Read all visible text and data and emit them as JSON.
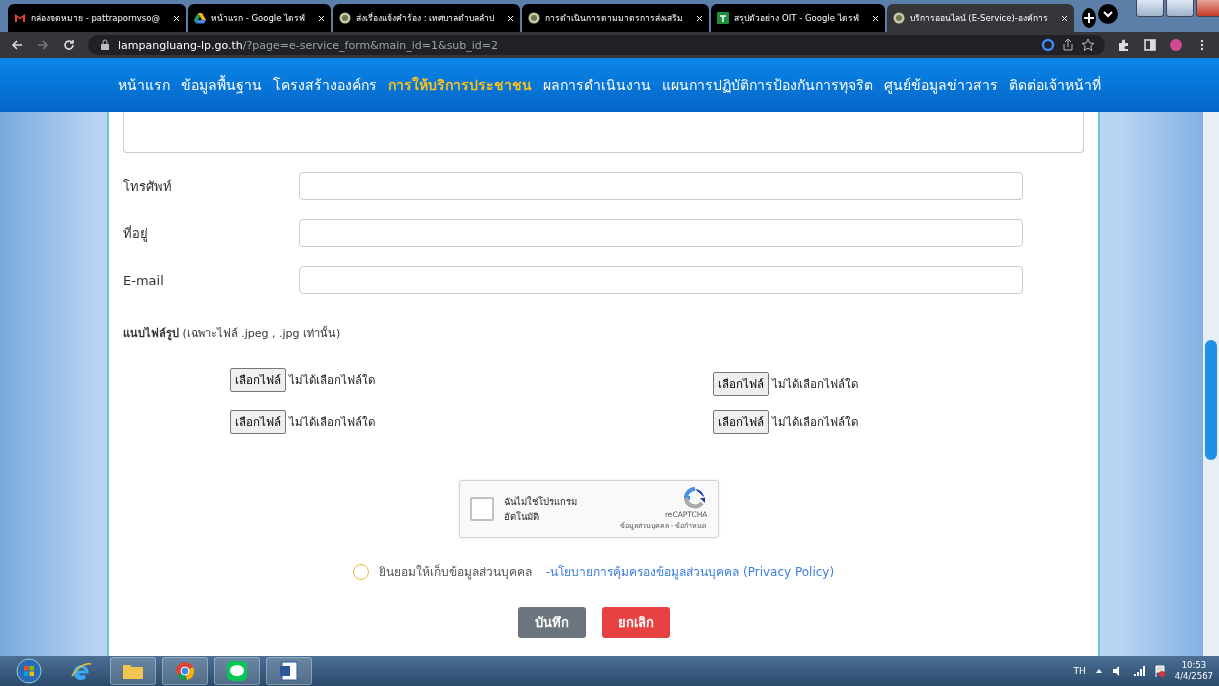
{
  "browser": {
    "tabs": [
      {
        "title": "กล่องจดหมาย - pattrapornvso@",
        "kind": "mail",
        "selected": false
      },
      {
        "title": "หน้าแรก - Google ไดรฟ์",
        "kind": "drive",
        "selected": false
      },
      {
        "title": "ส่งเรื่องแจ้งคำร้อง : เทศบาลตำบลลำป",
        "kind": "site",
        "selected": false
      },
      {
        "title": "การดำเนินการตามมาตรการส่งเสริม",
        "kind": "site",
        "selected": false
      },
      {
        "title": "สรุปตัวอย่าง OIT - Google ไดรฟ์",
        "kind": "sheet",
        "selected": false
      },
      {
        "title": "บริการออนไลน์ (E-Service)-องค์การ",
        "kind": "site",
        "selected": true
      }
    ],
    "url_host": "lampangluang-lp.go.th",
    "url_path": "/?page=e-service_form&main_id=1&sub_id=2"
  },
  "nav": [
    {
      "label": "หน้าแรก",
      "selected": false
    },
    {
      "label": "ข้อมูลพื้นฐาน",
      "selected": false
    },
    {
      "label": "โครงสร้างองค์กร",
      "selected": false
    },
    {
      "label": "การให้บริการประชาชน",
      "selected": true
    },
    {
      "label": "ผลการดำเนินงาน",
      "selected": false
    },
    {
      "label": "แผนการปฏิบัติการป้องกันการทุจริต",
      "selected": false
    },
    {
      "label": "ศูนย์ข้อมูลข่าวสาร",
      "selected": false
    },
    {
      "label": "ติดต่อเจ้าหน้าที่",
      "selected": false
    }
  ],
  "form": {
    "fields": [
      {
        "label": "โทรศัพท์"
      },
      {
        "label": "ที่อยู่"
      },
      {
        "label": "E-mail"
      }
    ],
    "attach_heading": "**แนบไฟล์รูป** (เฉพาะไฟล์ .jpeg , .jpg เท่านั้น)",
    "files": [
      {
        "button": "เลือกไฟล์",
        "status": "ไม่ได้เลือกไฟล์ใด"
      },
      {
        "button": "เลือกไฟล์",
        "status": "ไม่ได้เลือกไฟล์ใด"
      },
      {
        "button": "เลือกไฟล์",
        "status": "ไม่ได้เลือกไฟล์ใด"
      },
      {
        "button": "เลือกไฟล์",
        "status": "ไม่ได้เลือกไฟล์ใด"
      }
    ],
    "captcha": {
      "label": "ฉันไม่ใช่โปรแกรมอัตโนมัติ",
      "checked": false,
      "brand": "reCAPTCHA",
      "links": "ข้อมูลส่วนบุคคล - ข้อกำหนด"
    },
    "consent": {
      "label": "ยินยอมให้เก็บข้อมูลส่วนบุคคล",
      "checked": false,
      "link": "-นโยบายการคุ้มครองข้อมูลส่วนบุคคล (Privacy Policy)"
    },
    "buttons": [
      {
        "label": "บันทึก",
        "kind": "save"
      },
      {
        "label": "ยกเลิก",
        "kind": "cancel"
      }
    ]
  },
  "taskbar": {
    "language": "TH",
    "time": "10:53",
    "date": "4/4/2567"
  }
}
